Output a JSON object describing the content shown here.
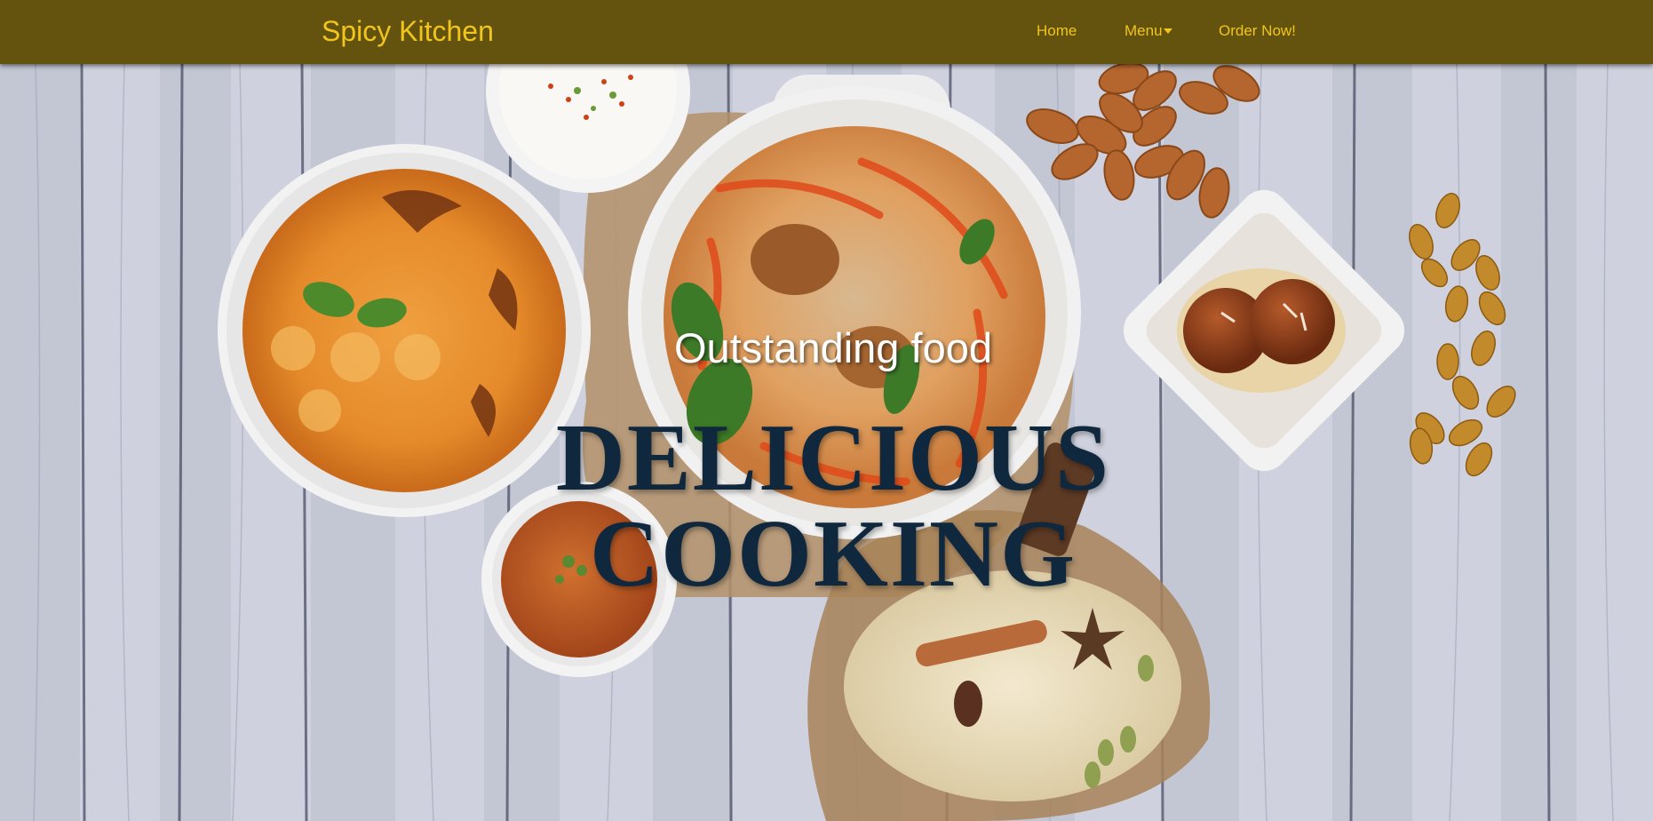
{
  "navbar": {
    "brand": "Spicy Kitchen",
    "links": {
      "home": "Home",
      "menu": "Menu",
      "order": "Order Now!"
    }
  },
  "hero": {
    "subtitle": "Outstanding food",
    "title_line1": "DELICIOUS",
    "title_line2": "COOKING"
  },
  "colors": {
    "navbar_bg": "#63530f",
    "nav_text": "#f1c51c",
    "title_text": "#10283d",
    "subtitle_text": "#ffffff"
  },
  "icons": {
    "menu_caret": "caret-down-icon"
  }
}
